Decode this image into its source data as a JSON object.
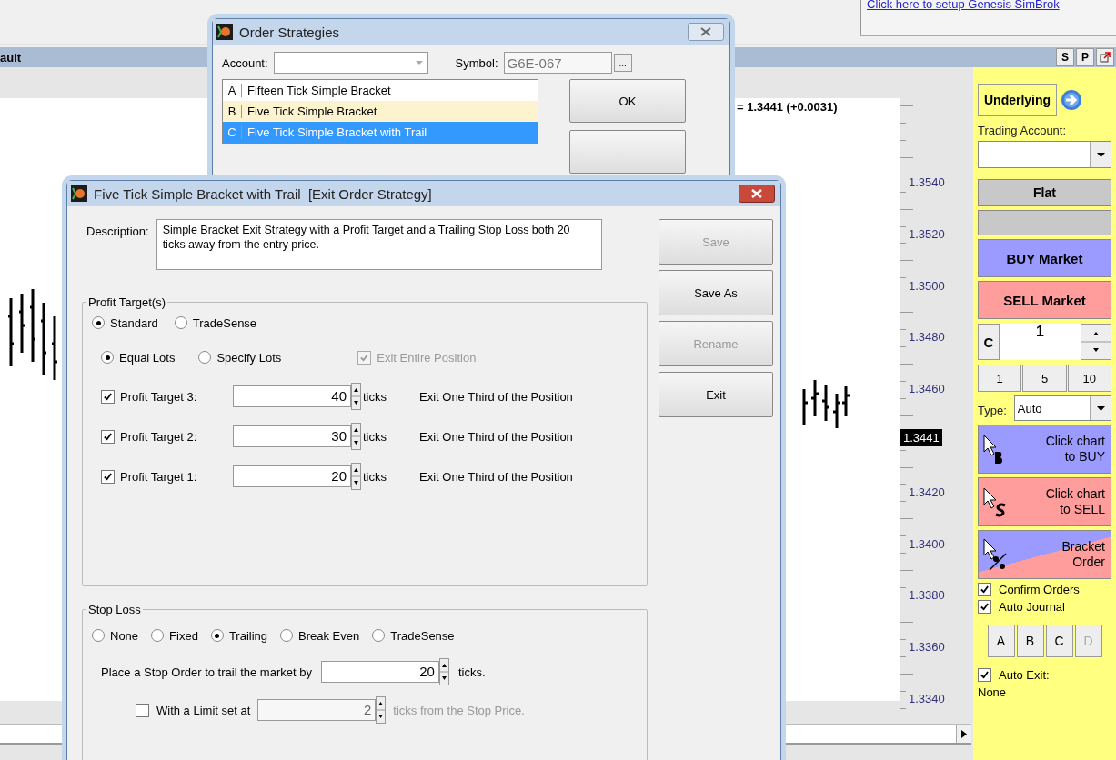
{
  "app": {
    "link": "Click here to setup Genesis SimBrok",
    "chart_title": "ault",
    "title_buttons": [
      "S",
      "P"
    ]
  },
  "chart": {
    "price_readout": "= 1.3441 (+0.0031)",
    "axis_labels": [
      "1.3540",
      "1.3520",
      "1.3500",
      "1.3480",
      "1.3460",
      "1.3420",
      "1.3400",
      "1.3380",
      "1.3360",
      "1.3340"
    ],
    "last_price": "1.3441"
  },
  "panel": {
    "underlying": "Underlying",
    "account_label": "Trading Account:",
    "position": "Flat",
    "buy": "BUY Market",
    "sell": "SELL Market",
    "clear": "C",
    "quantity": "1",
    "presets": [
      "1",
      "5",
      "10"
    ],
    "type_label": "Type:",
    "type_value": "Auto",
    "click_buy": "Click chart to BUY",
    "click_sell": "Click chart to SELL",
    "bracket": "Bracket Order",
    "options": [
      {
        "label": "Confirm Orders",
        "checked": true
      },
      {
        "label": "Auto Journal",
        "checked": true
      }
    ],
    "strategy_buttons": [
      {
        "label": "A",
        "disabled": false
      },
      {
        "label": "B",
        "disabled": false
      },
      {
        "label": "C",
        "disabled": false
      },
      {
        "label": "D",
        "disabled": true
      }
    ],
    "auto_exit": {
      "label": "Auto Exit:",
      "checked": true,
      "value": "None"
    }
  },
  "strategies_dialog": {
    "title": "Order Strategies",
    "account_label": "Account:",
    "symbol_label": "Symbol:",
    "symbol": "G6E-067",
    "browse": "...",
    "ok": "OK",
    "strategies": [
      {
        "letter": "A",
        "name": "Fifteen Tick Simple Bracket",
        "selected": false,
        "highlighted": false
      },
      {
        "letter": "B",
        "name": "Five Tick Simple Bracket",
        "selected": false,
        "highlighted": true
      },
      {
        "letter": "C",
        "name": "Five Tick Simple Bracket with Trail",
        "selected": true,
        "highlighted": false
      }
    ]
  },
  "exit_dialog": {
    "title": "Five Tick Simple Bracket with Trail  [Exit Order Strategy]",
    "description_label": "Description:",
    "description": "Simple Bracket Exit Strategy with a Profit Target and a Trailing Stop Loss both 20 ticks away from the entry price.",
    "buttons": [
      {
        "label": "Save",
        "disabled": true
      },
      {
        "label": "Save As",
        "disabled": false
      },
      {
        "label": "Rename",
        "disabled": true
      },
      {
        "label": "Exit",
        "disabled": false
      }
    ],
    "profit_targets": {
      "legend": "Profit Target(s)",
      "modes": [
        {
          "label": "Standard",
          "selected": true
        },
        {
          "label": "TradeSense",
          "selected": false
        }
      ],
      "lot_modes": [
        {
          "label": "Equal Lots",
          "selected": true
        },
        {
          "label": "Specify Lots",
          "selected": false
        }
      ],
      "exit_entire": {
        "label": "Exit Entire Position",
        "checked": true,
        "disabled": true
      },
      "targets": [
        {
          "label": "Profit Target 3:",
          "checked": true,
          "value": "40",
          "unit": "ticks",
          "note": "Exit One Third of the Position"
        },
        {
          "label": "Profit Target 2:",
          "checked": true,
          "value": "30",
          "unit": "ticks",
          "note": "Exit One Third of the Position"
        },
        {
          "label": "Profit Target 1:",
          "checked": true,
          "value": "20",
          "unit": "ticks",
          "note": "Exit One Third of the Position"
        }
      ]
    },
    "stop_loss": {
      "legend": "Stop Loss",
      "modes": [
        {
          "label": "None",
          "selected": false
        },
        {
          "label": "Fixed",
          "selected": false
        },
        {
          "label": "Trailing",
          "selected": true
        },
        {
          "label": "Break Even",
          "selected": false
        },
        {
          "label": "TradeSense",
          "selected": false
        }
      ],
      "trail_label": "Place a Stop Order to trail the market by",
      "trail_value": "20",
      "trail_unit": "ticks.",
      "limit": {
        "label": "With a Limit set at",
        "checked": false,
        "disabled": true,
        "value": "2",
        "suffix": "ticks from the Stop Price."
      }
    }
  }
}
